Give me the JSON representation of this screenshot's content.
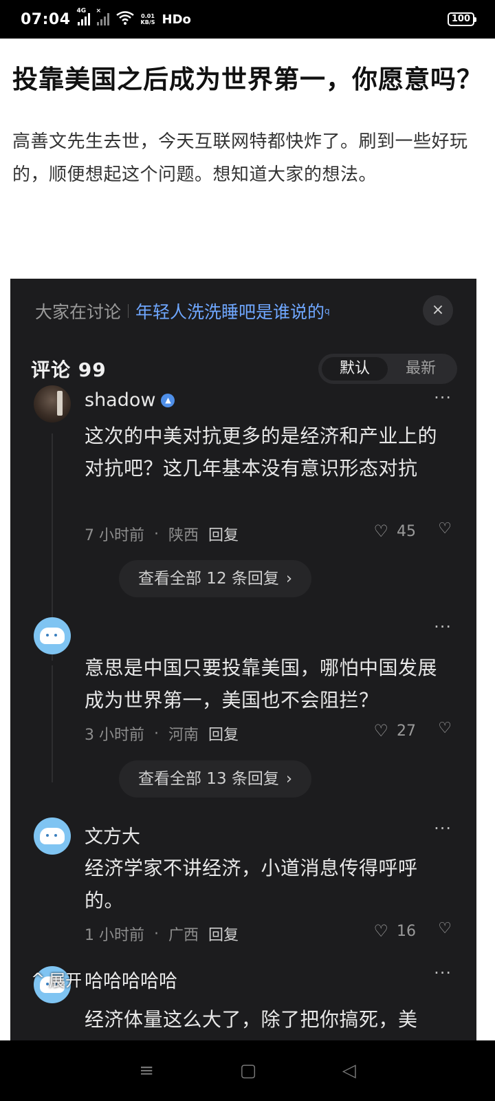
{
  "status_bar": {
    "time": "07:04",
    "signal1_tag": "4G",
    "signal2_tag": "×",
    "net_speed_value": "0.01",
    "net_speed_unit": "KB/S",
    "hd": "HDo",
    "battery": "100"
  },
  "article": {
    "title": "投靠美国之后成为世界第一，你愿意吗？",
    "body": "高善文先生去世，今天互联网特都快炸了。刷到一些好玩的，顺便想起这个问题。想知道大家的想法。"
  },
  "discussion": {
    "topic_label": "大家在讨论",
    "topic": "年轻人洗洗睡吧是谁说的",
    "topic_sup": "q",
    "close_icon": "×",
    "comment_count_label": "评论 99",
    "sort_default": "默认",
    "sort_latest": "最新",
    "comments": [
      {
        "username": "shadow",
        "text": "这次的中美对抗更多的是经济和产业上的对抗吧？这几年基本没有意识形态对抗",
        "time": "7 小时前",
        "location": "陕西",
        "reply": "回复",
        "likes": "45",
        "view_replies": "查看全部 12 条回复"
      },
      {
        "username": "",
        "text": "意思是中国只要投靠美国，哪怕中国发展成为世界第一，美国也不会阻拦？",
        "time": "3 小时前",
        "location": "河南",
        "reply": "回复",
        "likes": "27",
        "view_replies": "查看全部 13 条回复"
      },
      {
        "username": "文方大",
        "text": "经济学家不讲经济，小道消息传得呼呼的。",
        "time": "1 小时前",
        "location": "广西",
        "reply": "回复",
        "likes": "16"
      },
      {
        "username": "哈哈哈哈哈",
        "text": "经济体量这么大了，除了把你搞死，美"
      }
    ],
    "expand_label": "展开",
    "expand_icon": "^",
    "separator": "·",
    "more_icon": "···",
    "heart_icon": "♡",
    "dislike_icon": "♡",
    "chevron": "›"
  },
  "nav": {
    "menu_icon": "≡",
    "home_icon": "▢",
    "back_icon": "◁"
  },
  "colors": {
    "dark_panel": "#1c1c1e",
    "topic_link": "#6fa7ff",
    "status_bar": "#000000"
  }
}
